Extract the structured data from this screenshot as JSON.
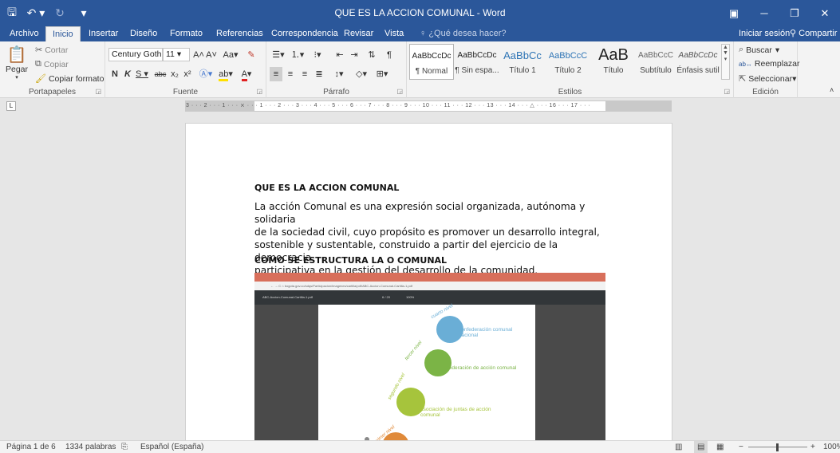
{
  "window": {
    "title": "QUE ES LA ACCION COMUNAL - Word"
  },
  "tabs": [
    "Archivo",
    "Inicio",
    "Insertar",
    "Diseño",
    "Formato",
    "Referencias",
    "Correspondencia",
    "Revisar",
    "Vista"
  ],
  "active_tab": "Inicio",
  "tell_me": "¿Qué desea hacer?",
  "account": {
    "signin": "Iniciar sesión",
    "share": "Compartir"
  },
  "clipboard": {
    "paste": "Pegar",
    "cut": "Cortar",
    "copy": "Copiar",
    "format_painter": "Copiar formato",
    "label": "Portapapeles"
  },
  "font": {
    "name": "Century Gothi",
    "size": "11",
    "label": "Fuente"
  },
  "paragraph": {
    "label": "Párrafo"
  },
  "styles": {
    "label": "Estilos",
    "items": [
      {
        "sample": "AaBbCcDc",
        "name": "¶ Normal"
      },
      {
        "sample": "AaBbCcDc",
        "name": "¶ Sin espa..."
      },
      {
        "sample": "AaBbCc",
        "name": "Título 1"
      },
      {
        "sample": "AaBbCcC",
        "name": "Título 2"
      },
      {
        "sample": "AaB",
        "name": "Título"
      },
      {
        "sample": "AaBbCcC",
        "name": "Subtítulo"
      },
      {
        "sample": "AaBbCcDc",
        "name": "Énfasis sutil"
      }
    ]
  },
  "editing": {
    "find": "Buscar",
    "replace": "Reemplazar",
    "select": "Seleccionar",
    "label": "Edición"
  },
  "ruler": {
    "numbers": "3 · · · 2 · · · 1 · · · ⨯ · · · 1 · · · 2 · · · 3 · · · 4 · · · 5 · · · 6 · · · 7 · · · 8 · · · 9 · · · 10 · · · 11 · · · 12 · · · 13 · · · 14 · · · △ · · · 16 · · · 17 · · ·"
  },
  "document": {
    "heading1": "QUE ES LA ACCION COMUNAL",
    "paragraph_lines": [
      "La acción Comunal es una expresión social organizada, autónoma y solidaria",
      "de la sociedad civil, cuyo propósito es promover un desarrollo integral,",
      "sostenible y sustentable, construido a partir del ejercicio de la democracia",
      "participativa en la gestión del desarrollo de la comunidad."
    ],
    "heading2": "COMO SE ESTRUCTURA LA O COMUNAL"
  },
  "embedded": {
    "address": "← → C  ⌂  bogota.gov.co/sdqs/Participacion/imagenes/cartilla/pdf/ABC-Accion-Comunal-Cartilla-1.pdf",
    "pdf_title": "ABC-Accion-Comunal-Cartilla-1.pdf",
    "pdf_page": "6 / 20",
    "pdf_zoom": "100%",
    "levels": [
      {
        "arc": "cuarto nivel",
        "label": "confederación comunal nacional",
        "color": "#6aaed6"
      },
      {
        "arc": "tercer nivel",
        "label": "federación de acción comunal",
        "color": "#7bb446"
      },
      {
        "arc": "segundo nivel",
        "label": "asociación de juntas de acción comunal",
        "color": "#a6c43c"
      },
      {
        "arc": "primer nivel",
        "label": "",
        "color": "#e08a3a"
      }
    ]
  },
  "status": {
    "page": "Página 1 de 6",
    "words": "1334 palabras",
    "language": "Español (España)",
    "zoom": "100%"
  }
}
